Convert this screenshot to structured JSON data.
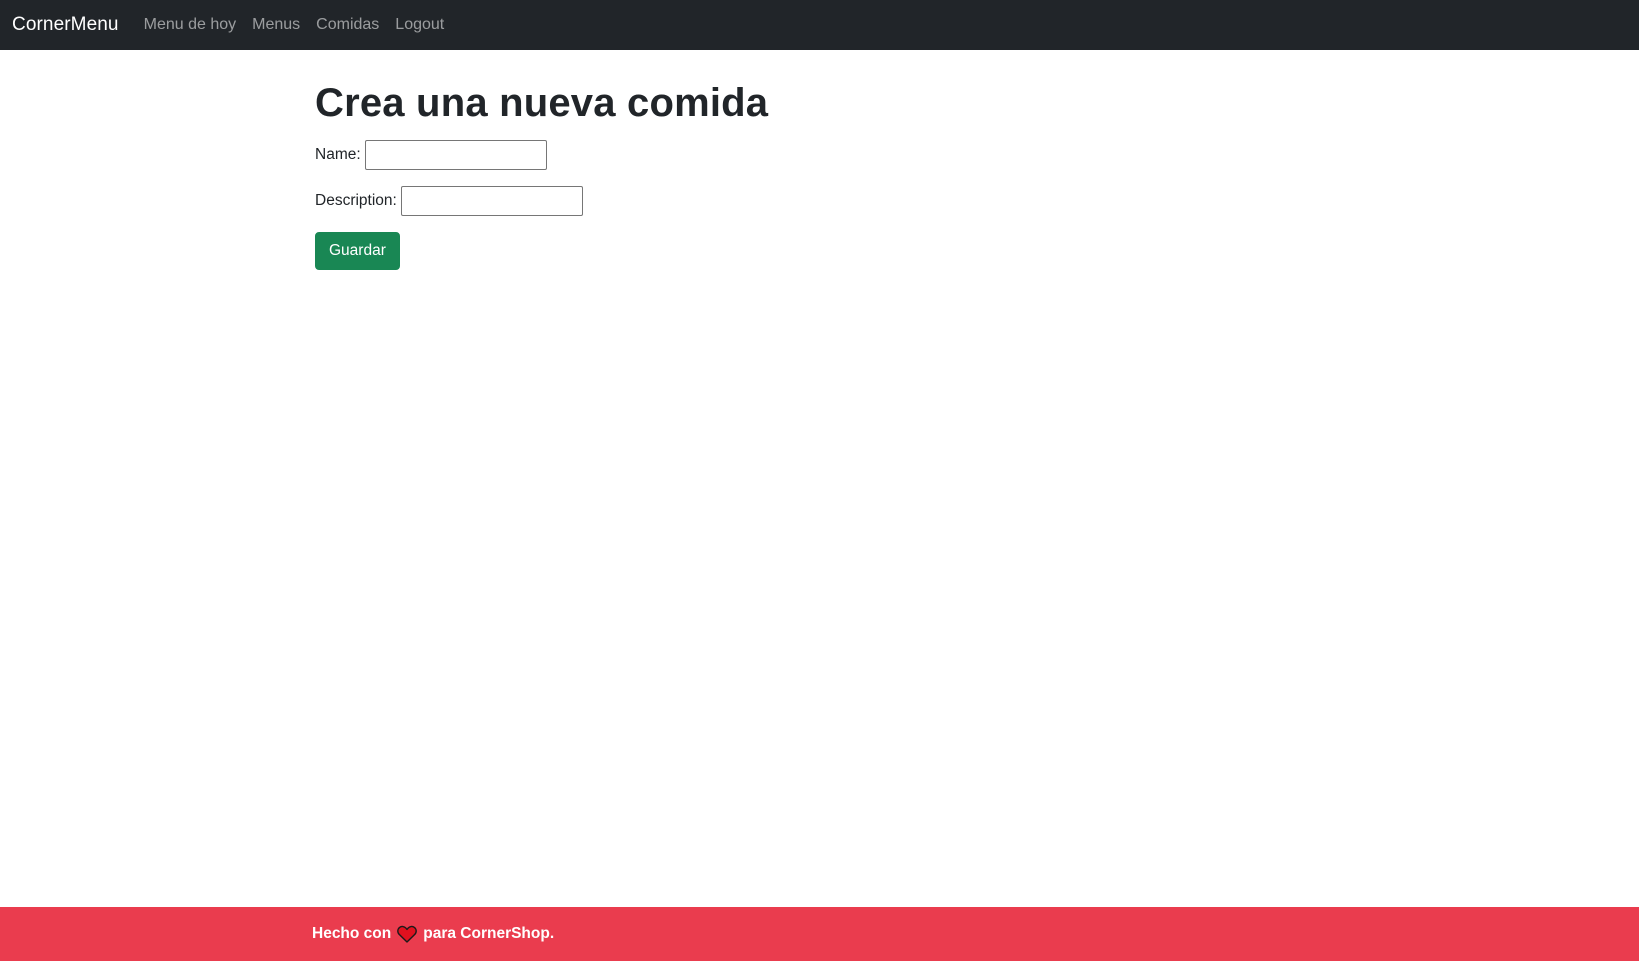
{
  "navbar": {
    "brand": "CornerMenu",
    "links": [
      "Menu de hoy",
      "Menus",
      "Comidas",
      "Logout"
    ]
  },
  "main": {
    "title": "Crea una nueva comida",
    "name_label": "Name:",
    "name_value": "",
    "description_label": "Description:",
    "description_value": "",
    "save_label": "Guardar"
  },
  "footer": {
    "text_before": "Hecho con",
    "heart_icon": "heart-icon",
    "text_after": "para CornerShop."
  },
  "colors": {
    "navbar_bg": "#212529",
    "save_button": "#198754",
    "footer_bg": "#ea3c4e"
  }
}
